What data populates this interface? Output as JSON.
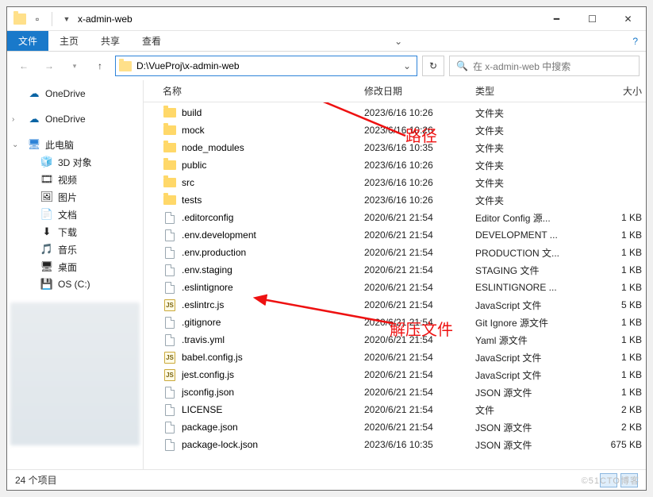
{
  "window": {
    "title": "x-admin-web"
  },
  "ribbon": {
    "file": "文件",
    "home": "主页",
    "share": "共享",
    "view": "查看"
  },
  "address_path": "D:\\VueProj\\x-admin-web",
  "search_placeholder": "在 x-admin-web 中搜索",
  "sidebar": {
    "onedrive1": "OneDrive",
    "onedrive2": "OneDrive",
    "thispc": "此电脑",
    "items": [
      {
        "icon": "🧊",
        "label": "3D 对象"
      },
      {
        "icon": "🎞",
        "label": "视频"
      },
      {
        "icon": "🖼",
        "label": "图片"
      },
      {
        "icon": "📄",
        "label": "文档"
      },
      {
        "icon": "⬇",
        "label": "下载"
      },
      {
        "icon": "🎵",
        "label": "音乐"
      },
      {
        "icon": "🖥",
        "label": "桌面"
      },
      {
        "icon": "💾",
        "label": "OS (C:)"
      }
    ]
  },
  "columns": {
    "name": "名称",
    "date": "修改日期",
    "type": "类型",
    "size": "大小"
  },
  "files": [
    {
      "icon": "folder",
      "name": "build",
      "date": "2023/6/16 10:26",
      "type": "文件夹",
      "size": ""
    },
    {
      "icon": "folder",
      "name": "mock",
      "date": "2023/6/16 10:26",
      "type": "文件夹",
      "size": ""
    },
    {
      "icon": "folder",
      "name": "node_modules",
      "date": "2023/6/16 10:35",
      "type": "文件夹",
      "size": ""
    },
    {
      "icon": "folder",
      "name": "public",
      "date": "2023/6/16 10:26",
      "type": "文件夹",
      "size": ""
    },
    {
      "icon": "folder",
      "name": "src",
      "date": "2023/6/16 10:26",
      "type": "文件夹",
      "size": ""
    },
    {
      "icon": "folder",
      "name": "tests",
      "date": "2023/6/16 10:26",
      "type": "文件夹",
      "size": ""
    },
    {
      "icon": "file",
      "name": ".editorconfig",
      "date": "2020/6/21 21:54",
      "type": "Editor Config 源...",
      "size": "1 KB"
    },
    {
      "icon": "file",
      "name": ".env.development",
      "date": "2020/6/21 21:54",
      "type": "DEVELOPMENT ...",
      "size": "1 KB"
    },
    {
      "icon": "file",
      "name": ".env.production",
      "date": "2020/6/21 21:54",
      "type": "PRODUCTION 文...",
      "size": "1 KB"
    },
    {
      "icon": "file",
      "name": ".env.staging",
      "date": "2020/6/21 21:54",
      "type": "STAGING 文件",
      "size": "1 KB"
    },
    {
      "icon": "file",
      "name": ".eslintignore",
      "date": "2020/6/21 21:54",
      "type": "ESLINTIGNORE ...",
      "size": "1 KB"
    },
    {
      "icon": "js",
      "name": ".eslintrc.js",
      "date": "2020/6/21 21:54",
      "type": "JavaScript 文件",
      "size": "5 KB"
    },
    {
      "icon": "file",
      "name": ".gitignore",
      "date": "2020/6/21 21:54",
      "type": "Git Ignore 源文件",
      "size": "1 KB"
    },
    {
      "icon": "file",
      "name": ".travis.yml",
      "date": "2020/6/21 21:54",
      "type": "Yaml 源文件",
      "size": "1 KB"
    },
    {
      "icon": "js",
      "name": "babel.config.js",
      "date": "2020/6/21 21:54",
      "type": "JavaScript 文件",
      "size": "1 KB"
    },
    {
      "icon": "js",
      "name": "jest.config.js",
      "date": "2020/6/21 21:54",
      "type": "JavaScript 文件",
      "size": "1 KB"
    },
    {
      "icon": "file",
      "name": "jsconfig.json",
      "date": "2020/6/21 21:54",
      "type": "JSON 源文件",
      "size": "1 KB"
    },
    {
      "icon": "file",
      "name": "LICENSE",
      "date": "2020/6/21 21:54",
      "type": "文件",
      "size": "2 KB"
    },
    {
      "icon": "file",
      "name": "package.json",
      "date": "2020/6/21 21:54",
      "type": "JSON 源文件",
      "size": "2 KB"
    },
    {
      "icon": "file",
      "name": "package-lock.json",
      "date": "2023/6/16 10:35",
      "type": "JSON 源文件",
      "size": "675 KB"
    }
  ],
  "status": {
    "count": "24 个项目"
  },
  "annotations": {
    "path": "路径",
    "extract": "解压文件"
  },
  "watermark": "©51CTO博客"
}
